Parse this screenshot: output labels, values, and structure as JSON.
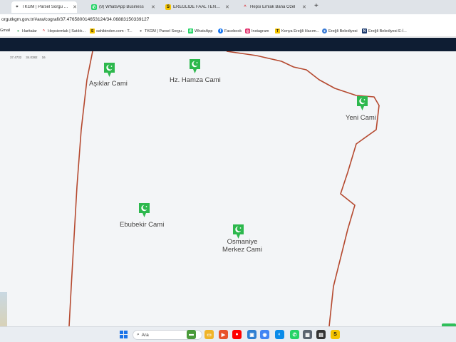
{
  "browser": {
    "tabs": [
      {
        "label": "TKGM | Parsel Sorgu Uygulama",
        "icon": "tkgm-pin-icon",
        "active": true
      },
      {
        "label": "(9) WhatsApp Business",
        "icon": "whatsapp-icon",
        "active": false
      },
      {
        "label": "EREĞLİDE FAAL TENEKE FABRİK",
        "icon": "sahibinden-s-icon",
        "active": false
      },
      {
        "label": "Hepsi Emlak Bana Özel",
        "icon": "hepsiemlak-roof-icon",
        "active": false
      }
    ],
    "new_tab": "+",
    "url": "orgutkgm.gov.tr/#ara/cografi/37.476580014653124/34.06883150339127",
    "bookmarks": [
      {
        "label": "Gmail",
        "icon": "gmail-icon",
        "color": "#ea4335"
      },
      {
        "label": "Haritalar",
        "icon": "maps-pin-icon",
        "color": "#34a853"
      },
      {
        "label": "Hepsiemlak | Satılık...",
        "icon": "hepsiemlak-roof-icon",
        "color": "#d9282f"
      },
      {
        "label": "sahibinden.com - T...",
        "icon": "sahibinden-s-icon",
        "color": "#f5c400"
      },
      {
        "label": "TKGM | Parsel Sorgu...",
        "icon": "tkgm-pin-icon",
        "color": "#444444"
      },
      {
        "label": "WhatsApp",
        "icon": "whatsapp-icon",
        "color": "#25d366"
      },
      {
        "label": "Facebook",
        "icon": "facebook-icon",
        "color": "#1877f2"
      },
      {
        "label": "Instagram",
        "icon": "instagram-icon",
        "color": "#e1306c"
      },
      {
        "label": "Konya Ereğli Hacım...",
        "icon": "t-letter-icon",
        "color": "#f5c400"
      },
      {
        "label": "Ereğli Belediyesi",
        "icon": "municipality-icon",
        "color": "#3a7bd5"
      },
      {
        "label": "Ereğli Belediyesi E-İ...",
        "icon": "n-letter-icon",
        "color": "#1d3b6e"
      }
    ]
  },
  "map": {
    "coords": {
      "lat": "37.4732",
      "lon": "34.0382",
      "zoom": "16"
    },
    "boundary_color": "#b5492f",
    "marker_color": "#2db84d",
    "mosques": [
      {
        "label": "Aşıklar Cami"
      },
      {
        "label": "Hz. Hamza Cami"
      },
      {
        "label": "Yeni Cami"
      },
      {
        "label": "Ebubekir Cami"
      },
      {
        "label": "Osmaniye\nMerkez Cami"
      }
    ]
  },
  "taskbar": {
    "search_label": "Ara",
    "apps": [
      {
        "name": "widget-car-icon",
        "color": "#4a9a3a"
      },
      {
        "name": "file-explorer-icon",
        "color": "#f0b429"
      },
      {
        "name": "media-player-icon",
        "color": "#e8532b"
      },
      {
        "name": "youtube-icon",
        "color": "#ff0000"
      },
      {
        "name": "ms-store-icon",
        "color": "#2f7fd1"
      },
      {
        "name": "chrome-icon",
        "color": "#4285f4"
      },
      {
        "name": "edge-icon",
        "color": "#0c8ce9"
      },
      {
        "name": "whatsapp-icon",
        "color": "#25d366"
      },
      {
        "name": "calculator-icon",
        "color": "#5b6470"
      },
      {
        "name": "photos-icon",
        "color": "#333333"
      },
      {
        "name": "sahibinden-s-icon",
        "color": "#f5c400"
      }
    ]
  }
}
